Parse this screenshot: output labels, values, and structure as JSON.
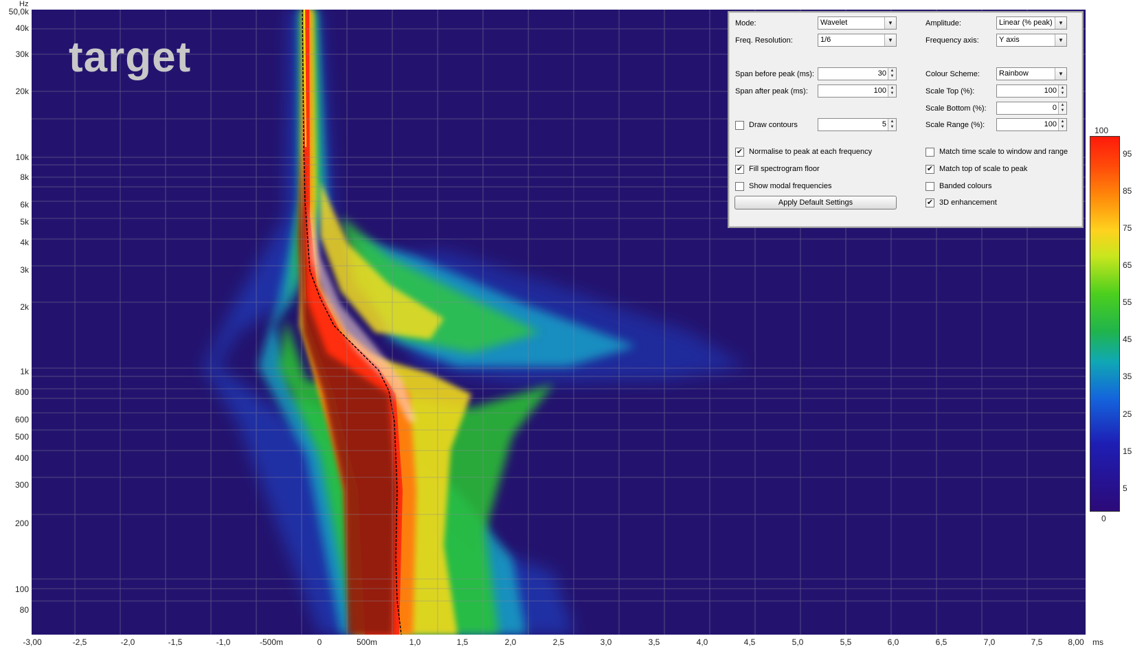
{
  "plot": {
    "label": "target",
    "y_unit": "Hz",
    "y_ticks": [
      "50,0k",
      "40k",
      "30k",
      "20k",
      "10k",
      "8k",
      "6k",
      "5k",
      "4k",
      "3k",
      "2k",
      "1k",
      "800",
      "600",
      "500",
      "400",
      "300",
      "200",
      "100",
      "80"
    ],
    "x_ticks": [
      "-3,00",
      "-2,5",
      "-2,0",
      "-1,5",
      "-1,0",
      "-500m",
      "0",
      "500m",
      "1,0",
      "1,5",
      "2,0",
      "2,5",
      "3,0",
      "3,5",
      "4,0",
      "4,5",
      "5,0",
      "5,5",
      "6,0",
      "6,5",
      "7,0",
      "7,5",
      "8,00"
    ],
    "x_unit": "ms",
    "background_color": "#24136e"
  },
  "colorbar": {
    "top_label": "100",
    "bottom_label": "0",
    "ticks": [
      "95",
      "85",
      "75",
      "65",
      "55",
      "45",
      "35",
      "25",
      "15",
      "5"
    ]
  },
  "settings": {
    "mode_label": "Mode:",
    "mode_value": "Wavelet",
    "freq_res_label": "Freq. Resolution:",
    "freq_res_value": "1/6",
    "amplitude_label": "Amplitude:",
    "amplitude_value": "Linear (% peak)",
    "freq_axis_label": "Frequency axis:",
    "freq_axis_value": "Y axis",
    "span_before_label": "Span before peak (ms):",
    "span_before_value": "30",
    "span_after_label": "Span after peak (ms):",
    "span_after_value": "100",
    "colour_scheme_label": "Colour Scheme:",
    "colour_scheme_value": "Rainbow",
    "scale_top_label": "Scale Top (%):",
    "scale_top_value": "100",
    "scale_bottom_label": "Scale Bottom (%):",
    "scale_bottom_value": "0",
    "scale_range_label": "Scale Range (%):",
    "scale_range_value": "100",
    "draw_contours_label": "Draw contours",
    "draw_contours_checked": false,
    "contours_value": "5",
    "normalise_label": "Normalise to peak at each frequency",
    "normalise_checked": true,
    "fill_floor_label": "Fill spectrogram floor",
    "fill_floor_checked": true,
    "show_modal_label": "Show modal frequencies",
    "show_modal_checked": false,
    "match_time_label": "Match time scale to window and range",
    "match_time_checked": false,
    "match_top_label": "Match top of scale to peak",
    "match_top_checked": true,
    "banded_label": "Banded colours",
    "banded_checked": false,
    "enhancement_label": "3D enhancement",
    "enhancement_checked": true,
    "apply_button_label": "Apply Default Settings"
  }
}
